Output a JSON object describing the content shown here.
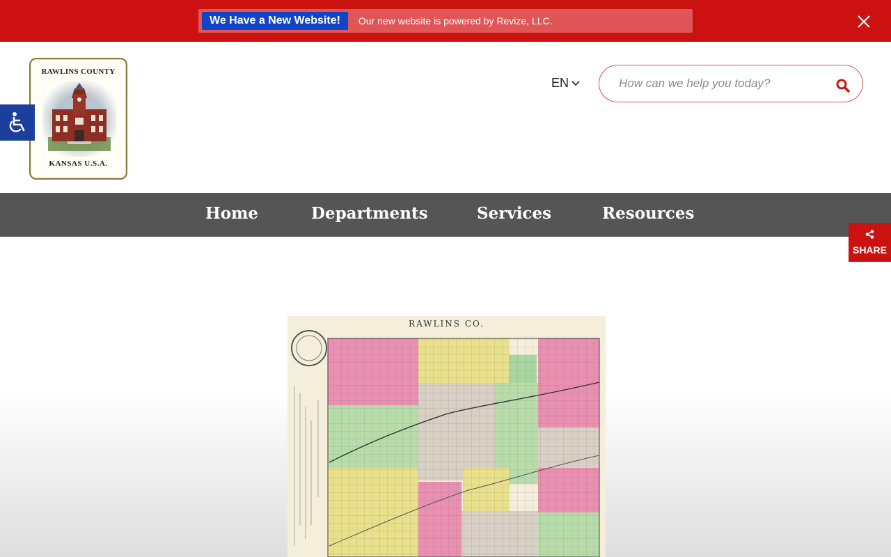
{
  "alert": {
    "badge": "We Have a New Website!",
    "message": "Our new website is powered by Revize, LLC."
  },
  "logo": {
    "top_text": "RAWLINS COUNTY",
    "bottom_text": "KANSAS U.S.A."
  },
  "language": {
    "selected": "EN"
  },
  "search": {
    "placeholder": "How can we help you today?"
  },
  "nav": {
    "items": [
      {
        "label": "Home"
      },
      {
        "label": "Departments"
      },
      {
        "label": "Services"
      },
      {
        "label": "Resources"
      }
    ]
  },
  "share": {
    "label": "SHARE"
  },
  "map": {
    "title": "RAWLINS CO."
  },
  "colors": {
    "alert_red": "#cc1111",
    "badge_blue": "#1144c8",
    "accessibility_blue": "#1c3f9e",
    "nav_gray": "#555555"
  },
  "icons": {
    "close": "close-icon",
    "accessibility": "wheelchair-icon",
    "language_dropdown": "chevron-down-icon",
    "search": "search-icon",
    "share": "share-icon"
  }
}
